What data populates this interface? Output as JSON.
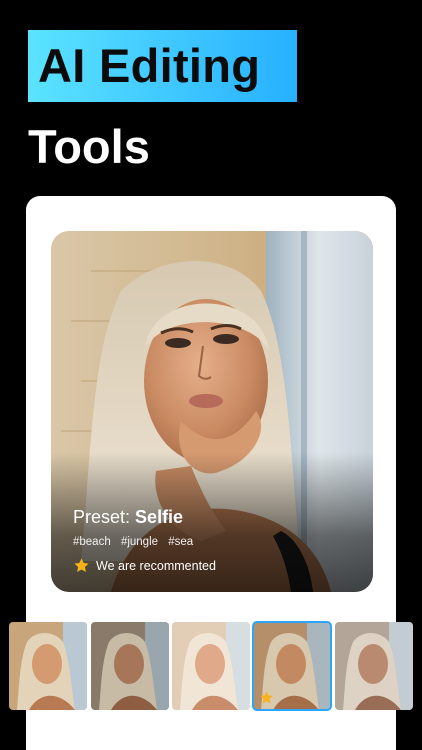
{
  "headline": {
    "highlight": "AI Editing",
    "second_line": "Tools"
  },
  "photo_card": {
    "preset_label": "Preset:",
    "preset_name": "Selfie",
    "tags": [
      "#beach",
      "#jungle",
      "#sea"
    ],
    "recommendation": "We are recommented"
  },
  "thumbnails": [
    {
      "name": "thumb-1",
      "selected": false
    },
    {
      "name": "thumb-2",
      "selected": false
    },
    {
      "name": "thumb-3",
      "selected": false
    },
    {
      "name": "thumb-4",
      "selected": true
    },
    {
      "name": "thumb-5",
      "selected": false
    }
  ],
  "colors": {
    "accent_start": "#5be3ff",
    "accent_end": "#27b0ff",
    "selected_border": "#2aa6ff",
    "star": "#f6b31a"
  },
  "icons": {
    "recommend": "star-icon",
    "thumb_badge": "star-icon"
  }
}
